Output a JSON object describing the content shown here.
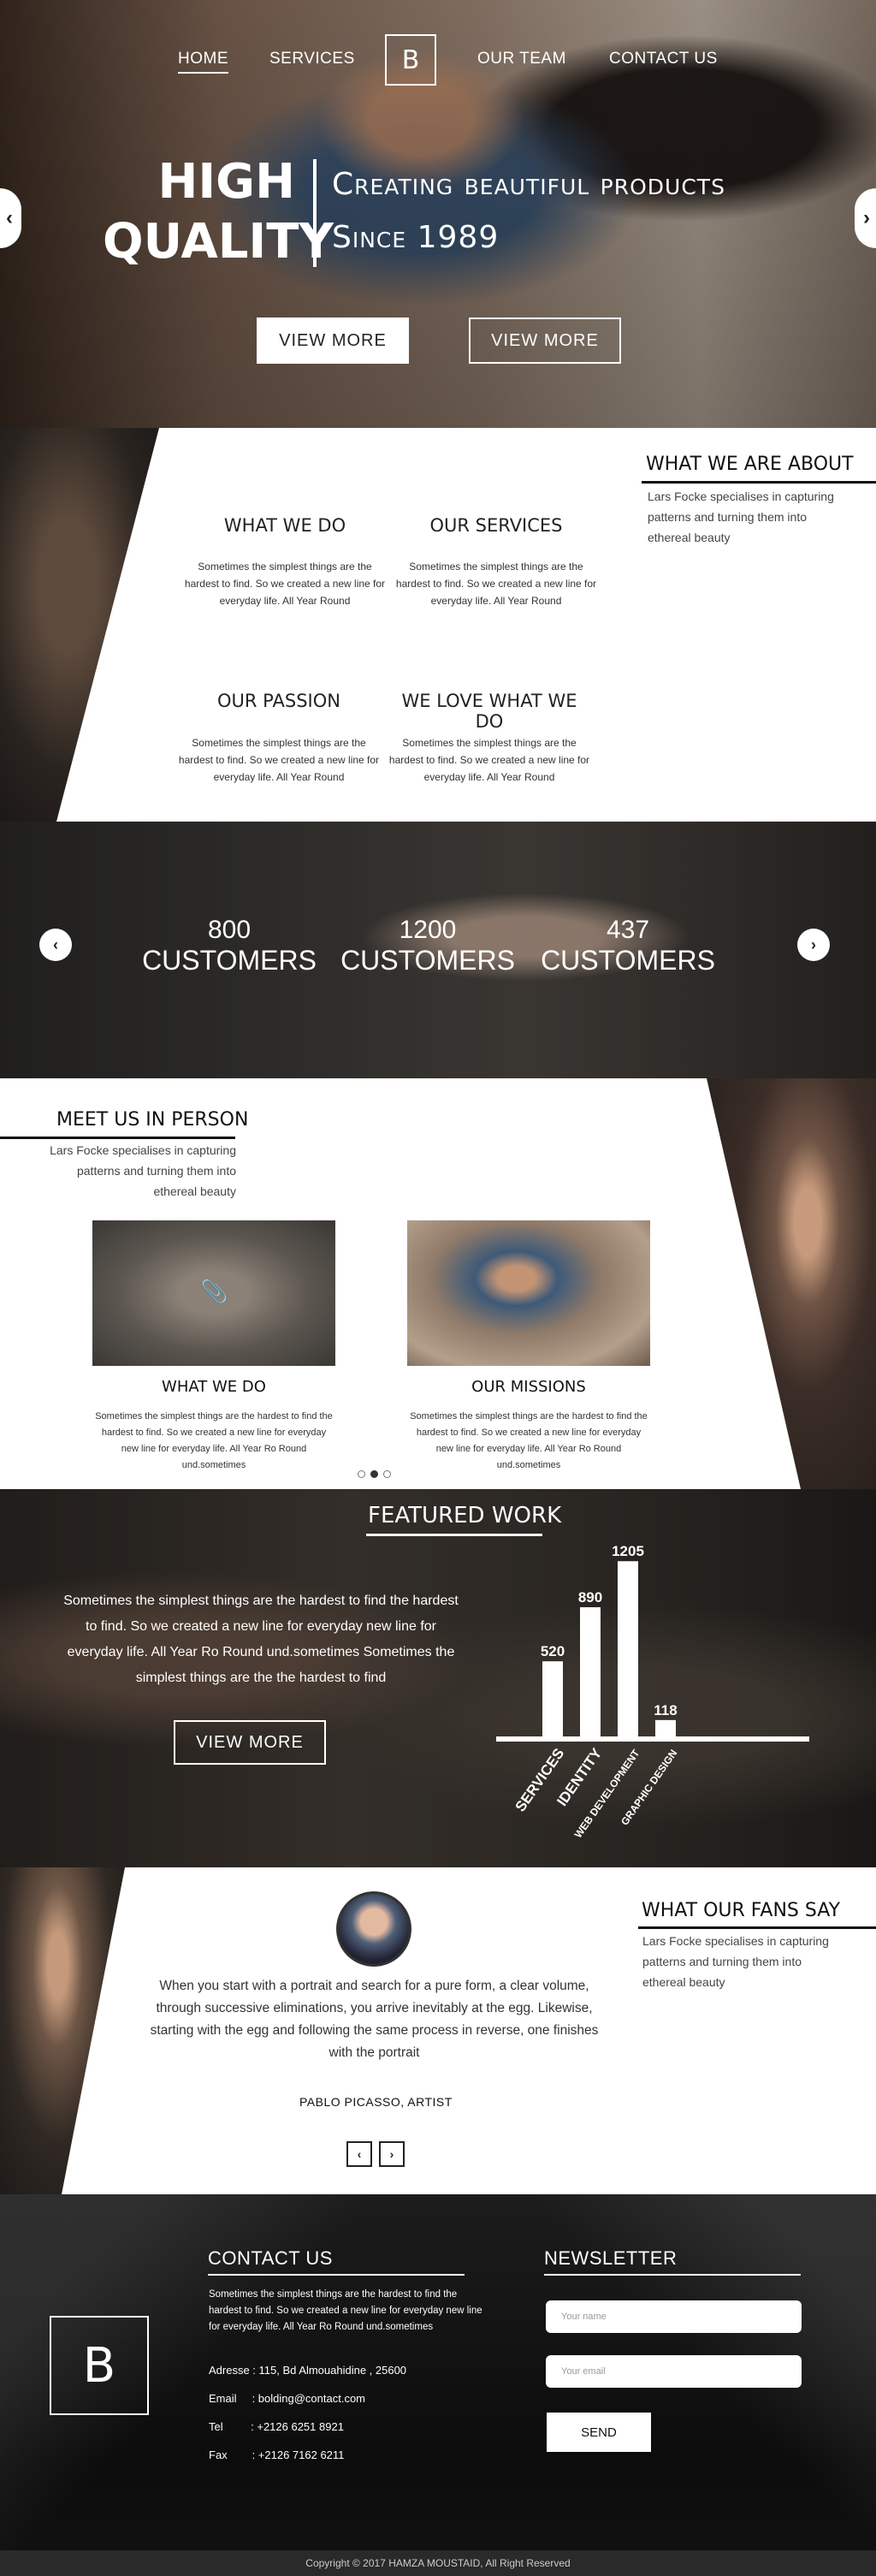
{
  "nav": {
    "items": [
      "HOME",
      "SERVICES",
      "OUR TEAM",
      "CONTACT US"
    ],
    "logo": "B"
  },
  "hero": {
    "big_line1": "HIGH",
    "big_line2": "QUALITY",
    "sub_line1": "Creating beautiful products",
    "sub_line2": "Since 1989",
    "button1": "VIEW MORE",
    "button2": "VIEW MORE",
    "prev_arrow": "‹",
    "next_arrow": "›"
  },
  "about": {
    "title": "WHAT WE ARE ABOUT",
    "text": "Lars Focke specialises in capturing patterns and turning them into ethereal beauty",
    "features": [
      {
        "title": "WHAT WE DO",
        "text": "Sometimes the simplest things are the hardest to find. So we created a new line for everyday life. All Year Round"
      },
      {
        "title": "OUR SERVICES",
        "text": "Sometimes the simplest things are the hardest to find. So we created a new line for everyday life. All Year Round"
      },
      {
        "title": "OUR PASSION",
        "text": "Sometimes the simplest things are the hardest to find. So we created a new line for everyday life. All Year Round"
      },
      {
        "title": "WE LOVE WHAT WE DO",
        "text": "Sometimes the simplest things are the hardest to find. So we created a new line for everyday life. All Year Round"
      }
    ]
  },
  "counters": {
    "items": [
      {
        "number": "800",
        "label": "CUSTOMERS"
      },
      {
        "number": "1200",
        "label": "CUSTOMERS"
      },
      {
        "number": "437",
        "label": "CUSTOMERS"
      }
    ],
    "prev_arrow": "‹",
    "next_arrow": "›"
  },
  "meet": {
    "title": "MEET US IN PERSON",
    "text": "Lars Focke specialises in capturing patterns and turning them into ethereal beauty",
    "cards": [
      {
        "title": "WHAT WE DO",
        "text": "Sometimes the simplest things are the hardest to find the hardest to find. So we created a new line for everyday new line for everyday life. All Year Ro Round und.sometimes"
      },
      {
        "title": "OUR MISSIONS",
        "text": "Sometimes the simplest things are the hardest to find the hardest to find. So we created a new line for everyday new line for everyday life. All Year Ro Round und.sometimes"
      }
    ],
    "active_slide": 2,
    "slide_count": 3
  },
  "featured": {
    "title": "FEATURED WORK",
    "text": "Sometimes the simplest things are the hardest to find the hardest to find. So we created a new line for everyday new line for everyday life. All Year Ro Round und.sometimes Sometimes the simplest things are the the hardest to find",
    "button": "VIEW MORE"
  },
  "chart_data": {
    "type": "bar",
    "categories": [
      "SERVICES",
      "IDENTITY",
      "WEB DEVELOPMENT",
      "GRAPHIC DESIGN"
    ],
    "values": [
      520,
      890,
      1205,
      118
    ],
    "title": "",
    "xlabel": "",
    "ylabel": "",
    "ylim": [
      0,
      1300
    ],
    "bar_color": "#ffffff"
  },
  "fans": {
    "title": "WHAT OUR FANS SAY",
    "text": "Lars Focke specialises in capturing patterns and turning them into ethereal beauty",
    "quote": "When you start with a portrait and search for a pure form, a clear volume, through successive eliminations, you arrive inevitably at the egg. Likewise, starting with the egg and following the same process in reverse, one finishes with the portrait",
    "author": "PABLO PICASSO, ARTIST",
    "prev": "‹",
    "next": "›"
  },
  "footer": {
    "logo": "B",
    "contact_title": "CONTACT US",
    "contact_text": "Sometimes the simplest things are the hardest to find the hardest to find. So we created a new line for everyday new line for everyday life. All Year Ro Round und.sometimes",
    "address": "Adresse : 115, Bd Almouahidine , 25600",
    "email": "Email     : bolding@contact.com",
    "tel": "Tel         : +2126 6251 8921",
    "fax": "Fax        : +2126 7162 6211",
    "newsletter_title": "NEWSLETTER",
    "name_placeholder": "Your name",
    "email_placeholder": "Your email",
    "send": "SEND",
    "copyright": "Copyright © 2017 HAMZA MOUSTAID, All Right Reserved"
  },
  "colors": {
    "accent": "#ffffff",
    "dark": "#111111"
  }
}
